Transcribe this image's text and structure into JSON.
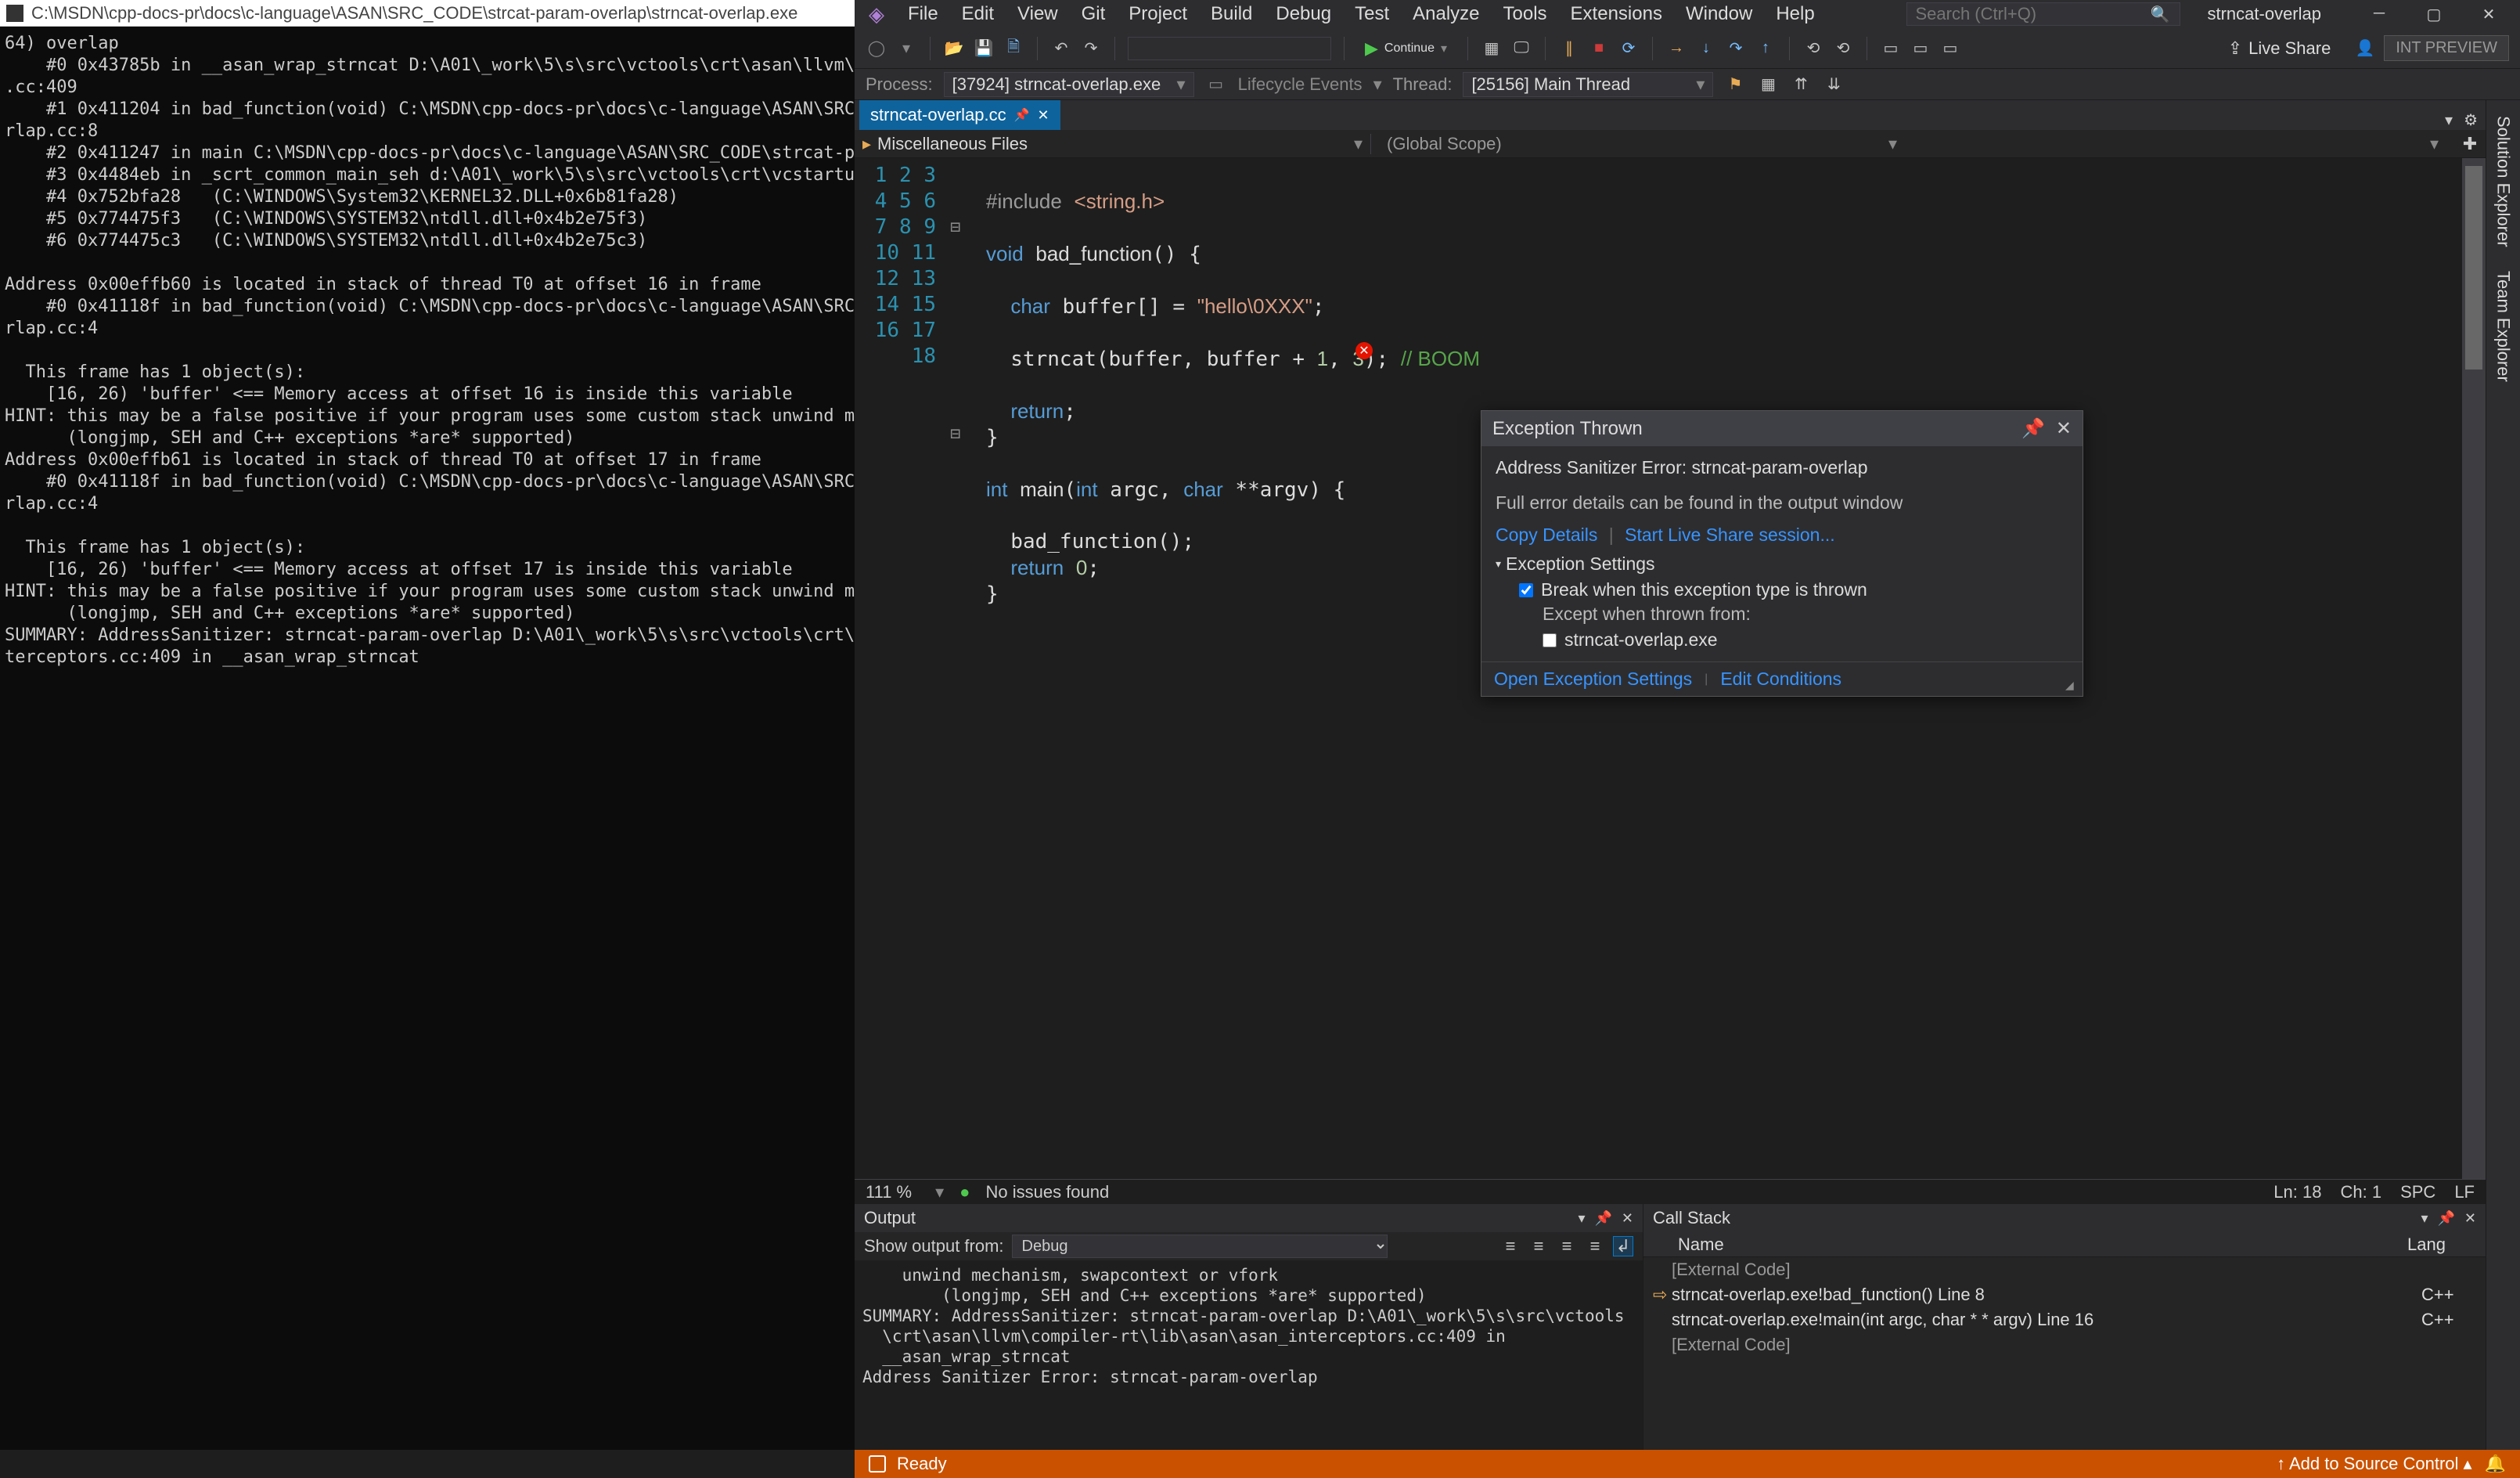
{
  "console": {
    "title": "C:\\MSDN\\cpp-docs-pr\\docs\\c-language\\ASAN\\SRC_CODE\\strcat-param-overlap\\strncat-overlap.exe",
    "text": "64) overlap\n    #0 0x43785b in __asan_wrap_strncat D:\\A01\\_work\\5\\s\\src\\vctools\\crt\\asan\\llvm\\co\n.cc:409\n    #1 0x411204 in bad_function(void) C:\\MSDN\\cpp-docs-pr\\docs\\c-language\\ASAN\\SRC_C\nrlap.cc:8\n    #2 0x411247 in main C:\\MSDN\\cpp-docs-pr\\docs\\c-language\\ASAN\\SRC_CODE\\strcat-par\n    #3 0x4484eb in _scrt_common_main_seh d:\\A01\\_work\\5\\s\\src\\vctools\\crt\\vcstartup\\\n    #4 0x752bfa28   (C:\\WINDOWS\\System32\\KERNEL32.DLL+0x6b81fa28)\n    #5 0x774475f3   (C:\\WINDOWS\\SYSTEM32\\ntdll.dll+0x4b2e75f3)\n    #6 0x774475c3   (C:\\WINDOWS\\SYSTEM32\\ntdll.dll+0x4b2e75c3)\n\nAddress 0x00effb60 is located in stack of thread T0 at offset 16 in frame\n    #0 0x41118f in bad_function(void) C:\\MSDN\\cpp-docs-pr\\docs\\c-language\\ASAN\\SRC_C\nrlap.cc:4\n\n  This frame has 1 object(s):\n    [16, 26) 'buffer' <== Memory access at offset 16 is inside this variable\nHINT: this may be a false positive if your program uses some custom stack unwind mec\n      (longjmp, SEH and C++ exceptions *are* supported)\nAddress 0x00effb61 is located in stack of thread T0 at offset 17 in frame\n    #0 0x41118f in bad_function(void) C:\\MSDN\\cpp-docs-pr\\docs\\c-language\\ASAN\\SRC_C\nrlap.cc:4\n\n  This frame has 1 object(s):\n    [16, 26) 'buffer' <== Memory access at offset 17 is inside this variable\nHINT: this may be a false positive if your program uses some custom stack unwind mec\n      (longjmp, SEH and C++ exceptions *are* supported)\nSUMMARY: AddressSanitizer: strncat-param-overlap D:\\A01\\_work\\5\\s\\src\\vctools\\crt\\as\nterceptors.cc:409 in __asan_wrap_strncat"
  },
  "vs": {
    "menu": [
      "File",
      "Edit",
      "View",
      "Git",
      "Project",
      "Build",
      "Debug",
      "Test",
      "Analyze",
      "Tools",
      "Extensions",
      "Window",
      "Help"
    ],
    "search_placeholder": "Search (Ctrl+Q)",
    "solution": "strncat-overlap",
    "toolbar": {
      "continue": "Continue",
      "live_share": "Live Share",
      "int_preview": "INT PREVIEW"
    },
    "debugbar": {
      "process_label": "Process:",
      "process_value": "[37924] strncat-overlap.exe",
      "lifecycle": "Lifecycle Events",
      "thread_label": "Thread:",
      "thread_value": "[25156] Main Thread"
    },
    "tab": "strncat-overlap.cc",
    "scope_left": "Miscellaneous Files",
    "scope_right": "(Global Scope)",
    "right_tabs": [
      "Solution Explorer",
      "Team Explorer"
    ],
    "status": {
      "zoom": "111 %",
      "issues": "No issues found",
      "ln": "Ln: 18",
      "ch": "Ch: 1",
      "spc": "SPC",
      "lf": "LF"
    },
    "code_lines": [
      "1",
      "2",
      "3",
      "4",
      "5",
      "6",
      "7",
      "8",
      "9",
      "10",
      "11",
      "12",
      "13",
      "14",
      "15",
      "16",
      "17",
      "18"
    ],
    "exception": {
      "title": "Exception Thrown",
      "subtitle": "Address Sanitizer Error: strncat-param-overlap",
      "hint": "Full error details can be found in the output window",
      "copy": "Copy Details",
      "liveshare": "Start Live Share session...",
      "settings_hdr": "Exception Settings",
      "break_label": "Break when this exception type is thrown",
      "except_label": "Except when thrown from:",
      "exe_name": "strncat-overlap.exe",
      "open_settings": "Open Exception Settings",
      "edit_cond": "Edit Conditions"
    },
    "output": {
      "title": "Output",
      "show_label": "Show output from:",
      "show_value": "Debug",
      "text": "    unwind mechanism, swapcontext or vfork\n        (longjmp, SEH and C++ exceptions *are* supported)\nSUMMARY: AddressSanitizer: strncat-param-overlap D:\\A01\\_work\\5\\s\\src\\vctools\n  \\crt\\asan\\llvm\\compiler-rt\\lib\\asan\\asan_interceptors.cc:409 in\n  __asan_wrap_strncat\nAddress Sanitizer Error: strncat-param-overlap"
    },
    "callstack": {
      "title": "Call Stack",
      "col_name": "Name",
      "col_lang": "Lang",
      "rows": [
        {
          "name": "[External Code]",
          "lang": "",
          "ext": true
        },
        {
          "name": "strncat-overlap.exe!bad_function() Line 8",
          "lang": "C++",
          "active": true
        },
        {
          "name": "strncat-overlap.exe!main(int argc, char * * argv) Line 16",
          "lang": "C++"
        },
        {
          "name": "[External Code]",
          "lang": "",
          "ext": true
        }
      ]
    },
    "statusbar": {
      "ready": "Ready",
      "source_control": "Add to Source Control"
    }
  }
}
